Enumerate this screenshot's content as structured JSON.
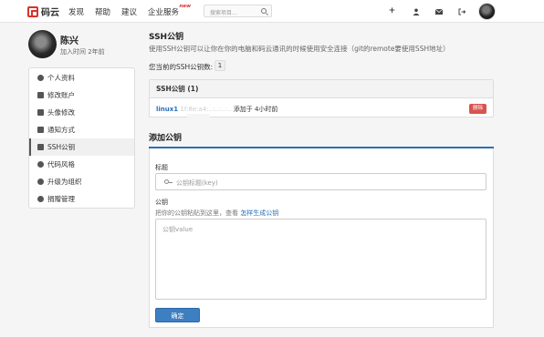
{
  "topbar": {
    "logo_text": "码云",
    "nav": [
      {
        "label": "发现"
      },
      {
        "label": "帮助"
      },
      {
        "label": "建议"
      },
      {
        "label": "企业服务",
        "badge": "new"
      }
    ],
    "search_placeholder": "搜索项目...",
    "icons": [
      "plus-icon",
      "user-icon",
      "mail-icon",
      "logout-icon"
    ]
  },
  "profile": {
    "name": "陈兴",
    "joined": "加入时间 2年前"
  },
  "sidebar": {
    "items": [
      {
        "label": "个人资料",
        "icon": "user-icon"
      },
      {
        "label": "修改账户",
        "icon": "pencil-icon"
      },
      {
        "label": "头像修改",
        "icon": "picture-icon"
      },
      {
        "label": "通知方式",
        "icon": "volume-icon"
      },
      {
        "label": "SSH公钥",
        "icon": "key-icon",
        "active": true
      },
      {
        "label": "代码风格",
        "icon": "palette-icon"
      },
      {
        "label": "升级为组织",
        "icon": "group-icon"
      },
      {
        "label": "捐赠管理",
        "icon": "gift-icon"
      }
    ]
  },
  "ssh": {
    "title": "SSH公钥",
    "description": "使用SSH公钥可以让你在你的电脑和码云通讯的时候使用安全连接（git的remote要使用SSH地址）",
    "count_label": "您当前的SSH公钥数:",
    "count": "1",
    "panel_title": "SSH公钥 (1)",
    "key": {
      "name": "linux1",
      "fingerprint": "1f:8e:a4:..:..:..:..",
      "added": "添加于 4小时前",
      "delete_label": "删除"
    }
  },
  "add": {
    "title": "添加公钥",
    "title_label": "标题",
    "title_placeholder": "公钥标题(key)",
    "key_label": "公钥",
    "key_hint": "把你的公钥粘贴到这里，查看",
    "key_hint_link": "怎样生成公钥",
    "key_placeholder": "公钥value",
    "submit_label": "确定"
  },
  "colors": {
    "brand": "#d6342b",
    "link": "#2a6fb8",
    "primary_button": "#3d7fc1",
    "danger": "#d9534f"
  }
}
